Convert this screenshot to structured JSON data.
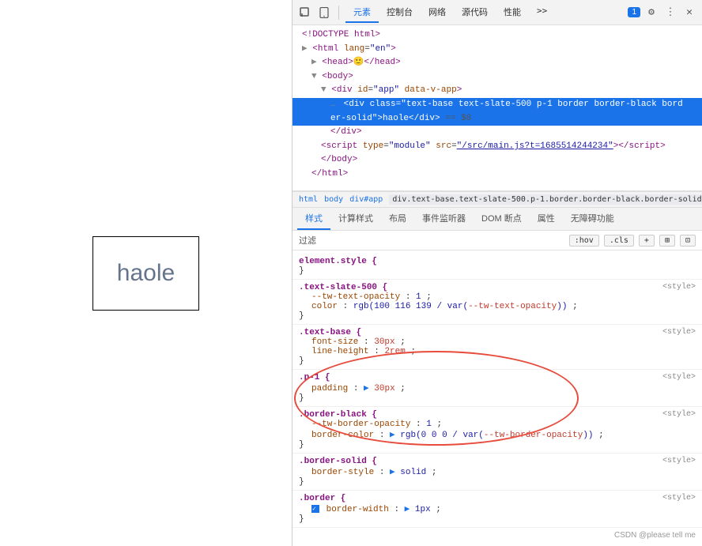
{
  "browser": {
    "content_text": "haole"
  },
  "devtools": {
    "toolbar": {
      "icons": [
        "cursor-icon",
        "mobile-icon"
      ],
      "tabs": [
        "元素",
        "控制台",
        "网络",
        "源代码",
        "性能",
        "more-tabs"
      ],
      "active_tab": "元素",
      "badge": "1",
      "settings_label": "⚙",
      "more_label": "⋮",
      "close_label": "✕"
    },
    "dom": {
      "lines": [
        {
          "indent": 1,
          "content": "<!DOCTYPE html>"
        },
        {
          "indent": 1,
          "content": "<html lang=\"en\">"
        },
        {
          "indent": 1,
          "toggle": "▶",
          "content": "<head>🙂</head>"
        },
        {
          "indent": 1,
          "toggle": "▼",
          "content": "<body>"
        },
        {
          "indent": 2,
          "toggle": "▼",
          "content": "<div id=\"app\" data-v-app>"
        },
        {
          "indent": 3,
          "ellipsis": true,
          "content": "<div class=\"text-base text-slate-500 p-1 border border-black bord",
          "selected": true,
          "suffix": "er-solid\">haole</div> == $0"
        },
        {
          "indent": 3,
          "content": "</div>"
        },
        {
          "indent": 2,
          "content": "<script type=\"module\" src=\"/src/main.js?t=1685514244234\"><\\/script>"
        },
        {
          "indent": 2,
          "content": "</body>"
        },
        {
          "indent": 1,
          "content": "</html>"
        }
      ]
    },
    "breadcrumb": {
      "items": [
        "html",
        "body",
        "div#app",
        "div.text-base.text-slate-500.p-1.border.border-black.border-solid"
      ]
    },
    "styles_tabs": [
      "样式",
      "计算样式",
      "布局",
      "事件监听器",
      "DOM 断点",
      "属性",
      "无障碍功能"
    ],
    "active_styles_tab": "样式",
    "filter": {
      "label": "过滤",
      "placeholder": "",
      "buttons": [
        ":hov",
        ".cls",
        "+",
        "⊞",
        "⊡"
      ]
    },
    "css_rules": [
      {
        "selector": "element.style {",
        "close": "}",
        "source": "",
        "properties": []
      },
      {
        "selector": ".text-slate-500 {",
        "close": "}",
        "source": "<style>",
        "properties": [
          {
            "name": "--tw-text-opacity",
            "value": "1",
            "color": "red"
          },
          {
            "name": "color",
            "value": "rgb(100 116 139 / var(--tw-text-opacity))",
            "color": "red"
          }
        ]
      },
      {
        "selector": ".text-base {",
        "close": "}",
        "source": "<style>",
        "properties": [
          {
            "name": "font-size",
            "value": "30px",
            "color": "red"
          },
          {
            "name": "line-height",
            "value": "2rem",
            "color": "red"
          }
        ]
      },
      {
        "selector": ".p-1 {",
        "close": "}",
        "source": "<style>",
        "properties": [
          {
            "name": "padding",
            "value": "▶ 30px",
            "color": "red",
            "has_triangle": true
          }
        ]
      },
      {
        "selector": ".border-black {",
        "close": "}",
        "source": "<style>",
        "properties": [
          {
            "name": "--tw-border-opacity",
            "value": "1",
            "color": "red"
          },
          {
            "name": "border-color",
            "value": "▶ rgb(0 0 0 / var(--tw-border-opacity))",
            "color": "red",
            "has_triangle": true
          }
        ]
      },
      {
        "selector": ".border-solid {",
        "close": "}",
        "source": "<style>",
        "properties": [
          {
            "name": "border-style",
            "value": "▶ solid",
            "color": "normal",
            "has_triangle": true
          }
        ]
      },
      {
        "selector": ".border {",
        "close": "}",
        "source": "<style>",
        "properties": [
          {
            "name": "border-width",
            "value": "▶ 1px",
            "color": "normal",
            "has_triangle": true,
            "has_checkbox": true
          }
        ]
      }
    ],
    "watermark": "CSDN @please tell me"
  }
}
